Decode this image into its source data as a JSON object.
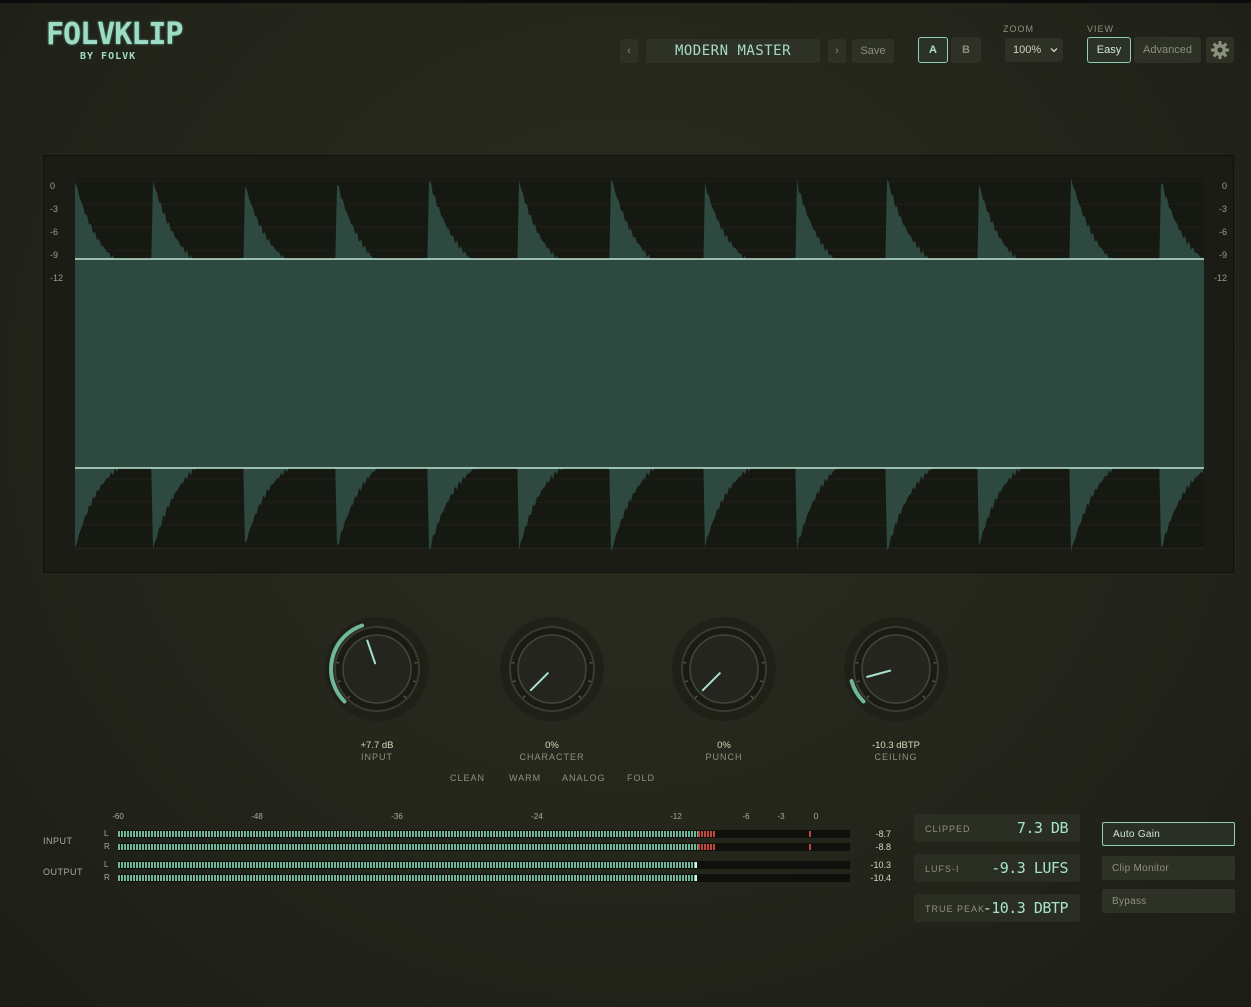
{
  "brand": {
    "name": "FOLVKLIP",
    "byline": "BY FOLVK"
  },
  "header": {
    "prev_label": "‹",
    "next_label": "›",
    "preset_name": "MODERN MASTER",
    "save_label": "Save",
    "ab": [
      {
        "label": "A",
        "active": true
      },
      {
        "label": "B",
        "active": false
      }
    ],
    "zoom_label": "ZOOM",
    "zoom_value": "100%",
    "view_label": "VIEW",
    "view_options": [
      {
        "label": "Easy",
        "active": true
      },
      {
        "label": "Advanced",
        "active": false
      }
    ],
    "settings_icon": "gear-icon"
  },
  "scope": {
    "left_scale": [
      "0",
      "-3",
      "-6",
      "-9",
      "-12"
    ],
    "right_scale": [
      "0",
      "-3",
      "-6",
      "-9",
      "-12"
    ],
    "ceiling_db": -10.3,
    "colors": {
      "fill": "#2e4a40",
      "line": "#bfe8d8",
      "background": "#1a1c15"
    }
  },
  "knobs": [
    {
      "name": "INPUT",
      "value": "+7.7 dB",
      "arc_fraction": 0.43
    },
    {
      "name": "CHARACTER",
      "value": "0%",
      "arc_fraction": 0.0
    },
    {
      "name": "PUNCH",
      "value": "0%",
      "arc_fraction": 0.0
    },
    {
      "name": "CEILING",
      "value": "-10.3 dBTP",
      "arc_fraction": 0.11
    }
  ],
  "character_modes": [
    "CLEAN",
    "WARM",
    "ANALOG",
    "FOLD"
  ],
  "meters": {
    "scale": [
      "-60",
      "-48",
      "-36",
      "-24",
      "-12",
      "-6",
      "-3",
      "0"
    ],
    "input_label": "INPUT",
    "output_label": "OUTPUT",
    "channels": [
      {
        "group": "input",
        "ch": "L",
        "value": "-8.7"
      },
      {
        "group": "input",
        "ch": "R",
        "value": "-8.8"
      },
      {
        "group": "output",
        "ch": "L",
        "value": "-10.3"
      },
      {
        "group": "output",
        "ch": "R",
        "value": "-10.4"
      }
    ]
  },
  "stats": [
    {
      "label": "CLIPPED",
      "value": "7.3 DB"
    },
    {
      "label": "LUFS-I",
      "value": "-9.3 LUFS"
    },
    {
      "label": "TRUE PEAK",
      "value": "-10.3 DBTP"
    }
  ],
  "side_buttons": [
    {
      "label": "Auto Gain",
      "active": true
    },
    {
      "label": "Clip Monitor",
      "active": false
    },
    {
      "label": "Bypass",
      "active": false
    }
  ],
  "accent": "#8fd1b8"
}
